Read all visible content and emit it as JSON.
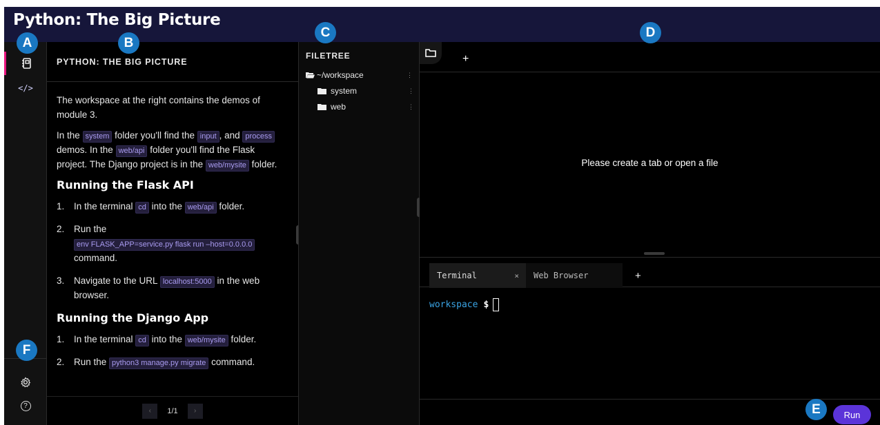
{
  "app": {
    "title": "Python: The Big Picture"
  },
  "callouts": [
    "A",
    "B",
    "C",
    "D",
    "E",
    "F"
  ],
  "rail": {
    "items": [
      {
        "icon": "notebook-icon",
        "glyph": "▤"
      },
      {
        "icon": "code-icon",
        "glyph": "</>"
      }
    ],
    "bottom": [
      {
        "icon": "gear-icon",
        "glyph": "⚙"
      },
      {
        "icon": "help-icon",
        "glyph": "?"
      }
    ]
  },
  "guide": {
    "heading": "PYTHON: THE BIG PICTURE",
    "intro": "The workspace at the right contains the demos of module 3.",
    "p2": {
      "t1": "In the ",
      "c1": "system",
      "t2": " folder you'll find the ",
      "c2": "input",
      "t3": ", and ",
      "c3": "process",
      "t4": " demos. In the ",
      "c4": "web/api",
      "t5": " folder you'll find the Flask project. The Django project is in the ",
      "c5": "web/mysite",
      "t6": " folder."
    },
    "flask": {
      "heading": "Running the Flask API",
      "s1": {
        "num": "1.",
        "t1": "In the terminal ",
        "c1": "cd",
        "t2": " into the ",
        "c2": "web/api",
        "t3": " folder."
      },
      "s2": {
        "num": "2.",
        "t1": "Run the",
        "c1": "env FLASK_APP=service.py flask run –host=0.0.0.0",
        "t2": "command."
      },
      "s3": {
        "num": "3.",
        "t1": "Navigate to the URL ",
        "c1": "localhost:5000",
        "t2": " in the web browser."
      }
    },
    "django": {
      "heading": "Running the Django App",
      "s1": {
        "num": "1.",
        "t1": "In the terminal ",
        "c1": "cd",
        "t2": " into the ",
        "c2": "web/mysite",
        "t3": " folder."
      },
      "s2": {
        "num": "2.",
        "t1": "Run the ",
        "c1": "python3 manage.py migrate",
        "t2": " command."
      }
    },
    "pager": {
      "prev": "‹",
      "page": "1/1",
      "next": "›"
    }
  },
  "filetree": {
    "heading": "FILETREE",
    "items": [
      {
        "label": "~/workspace",
        "icon": "folder-open-icon"
      },
      {
        "label": "system",
        "icon": "folder-icon"
      },
      {
        "label": "web",
        "icon": "folder-icon"
      }
    ]
  },
  "editor": {
    "add_tab": "+",
    "empty_message": "Please create a tab or open a file"
  },
  "terminal": {
    "tabs": [
      {
        "label": "Terminal",
        "close": "×"
      },
      {
        "label": "Web Browser"
      }
    ],
    "add_tab": "+",
    "prompt_dir": "workspace",
    "prompt_symbol": "$"
  },
  "run_label": "Run",
  "colors": {
    "accent": "#e9177f",
    "run": "#5b34d9",
    "code_text": "#a99bf0",
    "callout": "#1a78c2",
    "prompt": "#3aa3e3"
  }
}
